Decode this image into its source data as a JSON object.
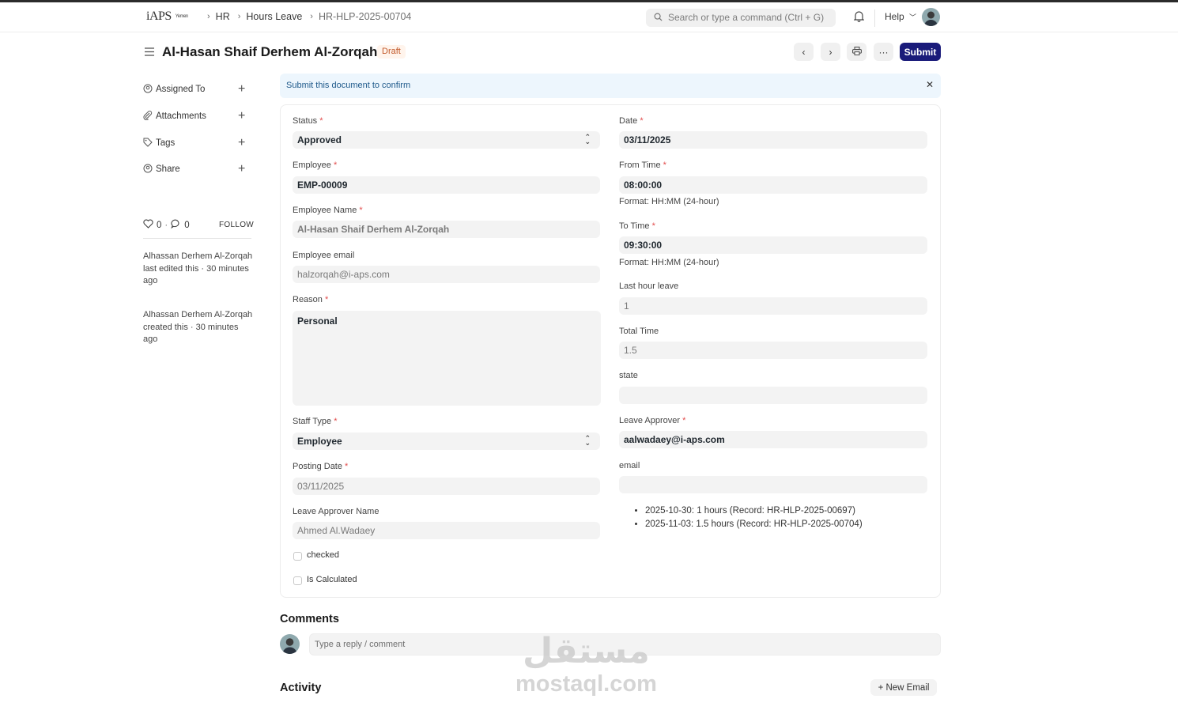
{
  "navbar": {
    "logo": "iAPS",
    "logo_sub": "Yemen",
    "breadcrumbs": [
      "HR",
      "Hours Leave",
      "HR-HLP-2025-00704"
    ],
    "search_placeholder": "Search or type a command (Ctrl + G)",
    "help_label": "Help"
  },
  "header": {
    "title": "Al-Hasan Shaif Derhem Al-Zorqah",
    "status_badge": "Draft",
    "submit_label": "Submit",
    "more_label": "···"
  },
  "sidebar": {
    "items": [
      {
        "label": "Assigned To",
        "icon": "assign-icon"
      },
      {
        "label": "Attachments",
        "icon": "paperclip-icon"
      },
      {
        "label": "Tags",
        "icon": "tag-icon"
      },
      {
        "label": "Share",
        "icon": "share-icon"
      }
    ],
    "likes": "0",
    "comments": "0",
    "follow_label": "FOLLOW",
    "timeline": [
      {
        "user": "Alhassan Derhem Al-Zorqah",
        "action": "last edited this · 30 minutes ago"
      },
      {
        "user": "Alhassan Derhem Al-Zorqah",
        "action": "created this · 30 minutes ago"
      }
    ]
  },
  "alert": {
    "text": "Submit this document to confirm"
  },
  "form": {
    "left": {
      "status": {
        "label": "Status",
        "value": "Approved"
      },
      "employee": {
        "label": "Employee",
        "value": "EMP-00009"
      },
      "employee_name": {
        "label": "Employee Name",
        "value": "Al-Hasan Shaif Derhem Al-Zorqah"
      },
      "employee_email": {
        "label": "Employee email",
        "value": "halzorqah@i-aps.com"
      },
      "reason": {
        "label": "Reason",
        "value": "Personal"
      },
      "staff_type": {
        "label": "Staff Type",
        "value": "Employee"
      },
      "posting_date": {
        "label": "Posting Date",
        "value": "03/11/2025"
      },
      "leave_approver_name": {
        "label": "Leave Approver Name",
        "value": "Ahmed Al.Wadaey"
      },
      "checked": {
        "label": "checked",
        "value": false
      },
      "is_calculated": {
        "label": "Is Calculated",
        "value": false
      }
    },
    "right": {
      "date": {
        "label": "Date",
        "value": "03/11/2025"
      },
      "from_time": {
        "label": "From Time",
        "value": "08:00:00",
        "hint": "Format: HH:MM (24-hour)"
      },
      "to_time": {
        "label": "To Time",
        "value": "09:30:00",
        "hint": "Format: HH:MM (24-hour)"
      },
      "last_hour_leave": {
        "label": "Last hour leave",
        "value": "1"
      },
      "total_time": {
        "label": "Total Time",
        "value": "1.5"
      },
      "state": {
        "label": "state",
        "value": ""
      },
      "leave_approver": {
        "label": "Leave Approver",
        "value": "aalwadaey@i-aps.com"
      },
      "email": {
        "label": "email",
        "value": ""
      },
      "history": [
        "2025-10-30: 1 hours (Record: HR-HLP-2025-00697)",
        "2025-11-03: 1.5 hours (Record: HR-HLP-2025-00704)"
      ]
    }
  },
  "comments": {
    "heading": "Comments",
    "placeholder": "Type a reply / comment"
  },
  "activity": {
    "heading": "Activity",
    "new_email_label": "+ New Email"
  },
  "watermark": {
    "arabic": "مستقل",
    "latin": "mostaql.com"
  },
  "colors": {
    "primary": "#1a1b7a",
    "draft_badge": "#c2592a",
    "alert_bg": "#edf6fd",
    "required": "#e24c4c"
  }
}
